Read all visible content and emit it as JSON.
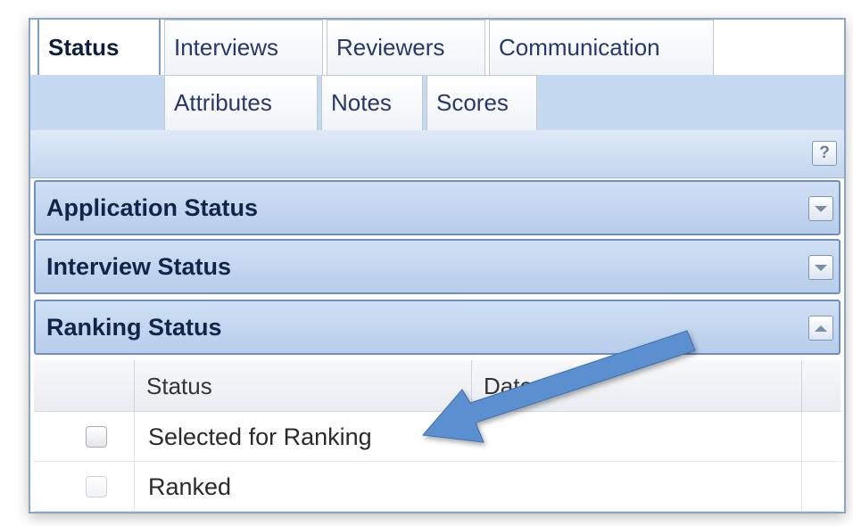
{
  "tabs": {
    "row1": [
      {
        "label": "Status",
        "active": true
      },
      {
        "label": "Interviews",
        "active": false
      },
      {
        "label": "Reviewers",
        "active": false
      },
      {
        "label": "Communication",
        "active": false
      }
    ],
    "row2": [
      {
        "label": "Attributes",
        "active": false
      },
      {
        "label": "Notes",
        "active": false
      },
      {
        "label": "Scores",
        "active": false
      }
    ]
  },
  "toolbar": {
    "help_label": "?"
  },
  "sections": [
    {
      "title": "Application Status",
      "expanded": false,
      "toggle_icon": "chevron-down-icon"
    },
    {
      "title": "Interview Status",
      "expanded": false,
      "toggle_icon": "chevron-down-icon"
    },
    {
      "title": "Ranking Status",
      "expanded": true,
      "toggle_icon": "chevron-up-icon"
    }
  ],
  "grid": {
    "columns": [
      "Status",
      "Date"
    ],
    "rows": [
      {
        "label": "Selected for Ranking",
        "checked": false,
        "enabled": true
      },
      {
        "label": "Ranked",
        "checked": false,
        "enabled": false
      }
    ]
  },
  "annotation": {
    "color": "#5b8fcf",
    "icon": "callout-arrow"
  }
}
